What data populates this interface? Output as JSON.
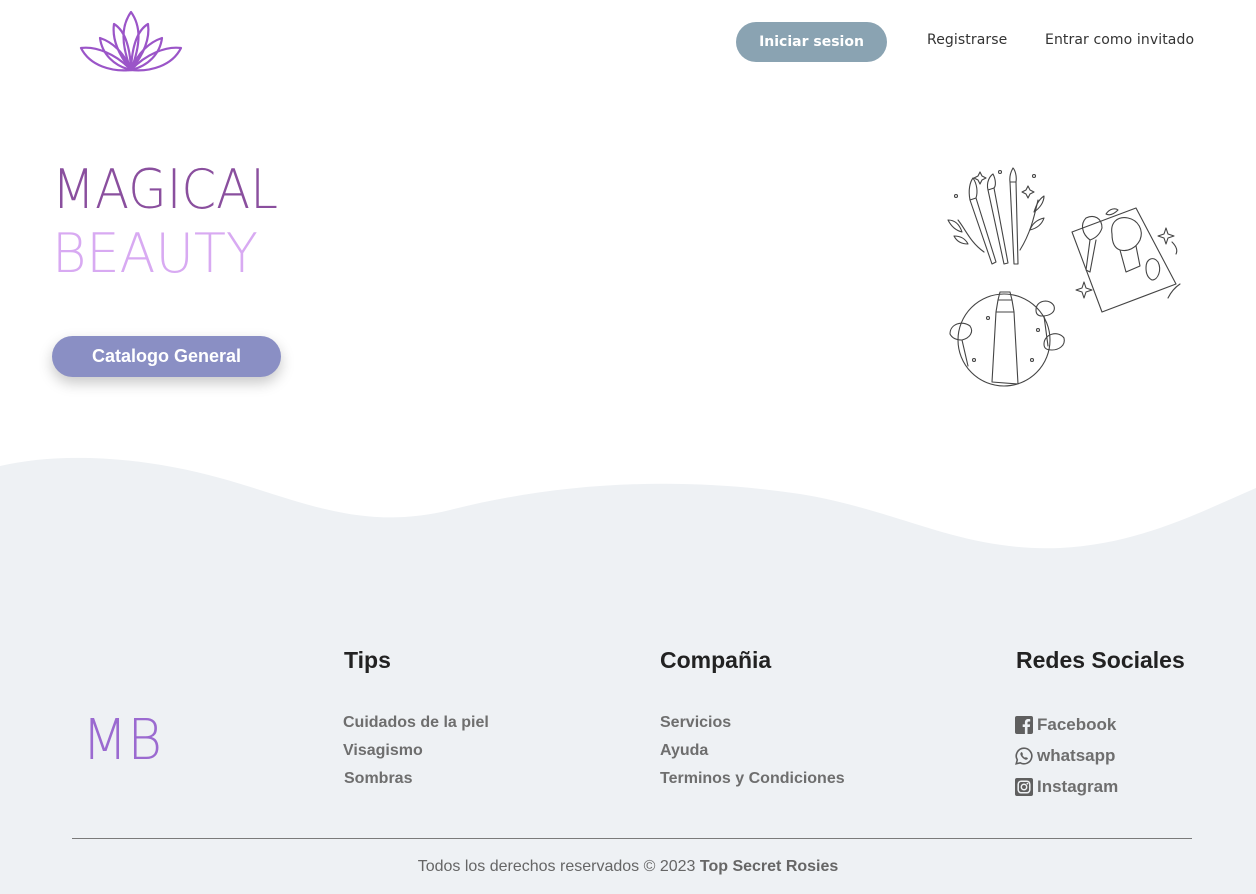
{
  "header": {
    "login_label": "Iniciar sesion",
    "register_label": "Registrarse",
    "guest_label": "Entrar como invitado"
  },
  "hero": {
    "title_line1": "MAGICAL",
    "title_line2": "BEAUTY",
    "catalog_label": "Catalogo General"
  },
  "footer": {
    "logo_text": "MB",
    "tips": {
      "title": "Tips",
      "links": [
        "Cuidados de la piel",
        "Visagismo",
        "Sombras"
      ]
    },
    "company": {
      "title": "Compañia",
      "links": [
        "Servicios",
        "Ayuda",
        "Terminos y Condiciones"
      ]
    },
    "social": {
      "title": "Redes Sociales",
      "links": [
        {
          "label": "Facebook",
          "icon": "facebook-icon"
        },
        {
          "label": "whatsapp",
          "icon": "whatsapp-icon"
        },
        {
          "label": "Instagram",
          "icon": "instagram-icon"
        }
      ]
    },
    "copyright_prefix": "Todos los derechos reservados © 2023",
    "copyright_brand": "Top Secret Rosies"
  },
  "colors": {
    "login_button": "#8aa3b2",
    "catalog_button": "#8a8fc4",
    "title_dark_purple": "#8a4f9e",
    "title_light_purple": "#d8aaf2",
    "logo_purple": "#9b55c8",
    "footer_background": "#eef1f4"
  }
}
